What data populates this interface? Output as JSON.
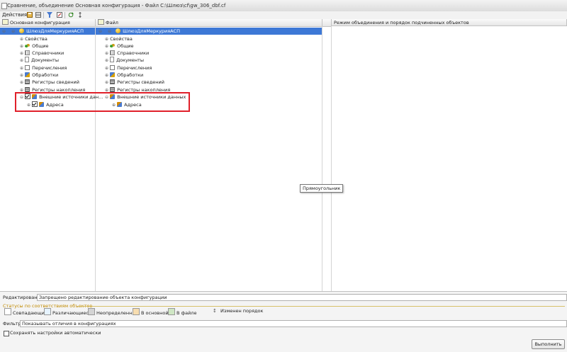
{
  "window": {
    "title": "Сравнение, объединение Основная конфигурация - Файл C:\\Шлюз\\cf\\gw_306_dbf.cf"
  },
  "toolbar": {
    "actions_label": "Действия ▾",
    "icons": [
      "save-icon",
      "compare-icon",
      "filter-icon",
      "refresh-icon",
      "move-icon"
    ]
  },
  "columns": {
    "left": "Основная конфигурация",
    "middle": "Файл",
    "right": "Режим объединения и порядок подчиненных объектов"
  },
  "left_tree": {
    "root": "ШлюзДляМеркурияАСП",
    "items": [
      {
        "label": "Свойства"
      },
      {
        "label": "Общие"
      },
      {
        "label": "Справочники"
      },
      {
        "label": "Документы"
      },
      {
        "label": "Перечисления"
      },
      {
        "label": "Обработки"
      },
      {
        "label": "Регистры сведений"
      },
      {
        "label": "Регистры накопления"
      },
      {
        "label": "Внешние источники дан..."
      },
      {
        "label": "Адреса"
      }
    ]
  },
  "middle_tree": {
    "root": "ШлюзДляМеркурияАСП",
    "items": [
      {
        "label": "Свойства"
      },
      {
        "label": "Общие"
      },
      {
        "label": "Справочники"
      },
      {
        "label": "Документы"
      },
      {
        "label": "Перечисления"
      },
      {
        "label": "Обработки"
      },
      {
        "label": "Регистры сведений"
      },
      {
        "label": "Регистры накопления"
      },
      {
        "label": "Внешние источники данных"
      },
      {
        "label": "Адреса"
      }
    ]
  },
  "tooltip": "Прямоугольник",
  "bottom": {
    "editing_label": "Редактирование:",
    "editing_value": "Запрещено редактирование объекта конфигурации",
    "statuses_title": "Статусы по соответствиям объектов",
    "statuses": [
      {
        "label": "Совпадающие",
        "color": "#ffffff"
      },
      {
        "label": "Различающиеся",
        "color": "#e6f3ff"
      },
      {
        "label": "Неопределенные",
        "color": "#d4d4d4"
      },
      {
        "label": "В основной",
        "color": "#f7ddb0"
      },
      {
        "label": "В файле",
        "color": "#cfe6c4"
      },
      {
        "label": "Изменен порядок",
        "color": "#ffffff"
      }
    ],
    "filter_label": "Фильтр:",
    "filter_value": "Показывать отличия в конфигурациях",
    "autosave_label": "Сохранять настройки автоматически",
    "execute_label": "Выполнить"
  }
}
